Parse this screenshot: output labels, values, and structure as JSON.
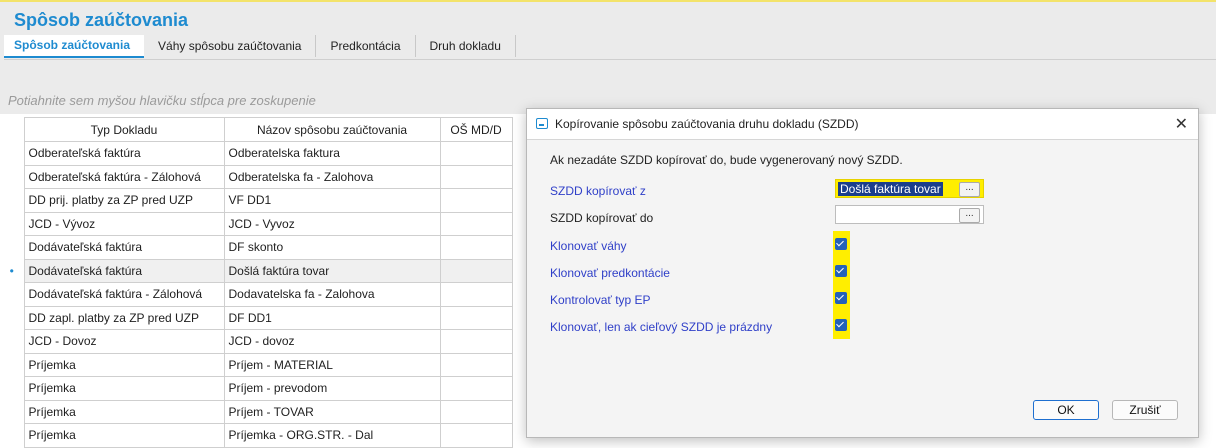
{
  "page": {
    "title": "Spôsob zaúčtovania",
    "tabs": [
      "Spôsob zaúčtovania",
      "Váhy spôsobu zaúčtovania",
      "Predkontácia",
      "Druh dokladu"
    ],
    "group_hint": "Potiahnite sem myšou hlavičku stĺpca pre zoskupenie"
  },
  "grid": {
    "columns": [
      "Typ Dokladu",
      "Názov spôsobu zaúčtovania",
      "OŠ MD/D"
    ],
    "rows": [
      [
        "Odberateľská faktúra",
        "Odberatelska faktura",
        ""
      ],
      [
        "Odberateľská faktúra - Zálohová",
        "Odberatelska fa - Zalohova",
        ""
      ],
      [
        "DD prij. platby za ZP pred UZP",
        "VF DD1",
        ""
      ],
      [
        "JCD - Vývoz",
        "JCD - Vyvoz",
        ""
      ],
      [
        "Dodávateľská faktúra",
        "DF skonto",
        ""
      ],
      [
        "Dodávateľská faktúra",
        "Došlá faktúra tovar",
        ""
      ],
      [
        "Dodávateľská faktúra - Zálohová",
        "Dodavatelska fa - Zalohova",
        ""
      ],
      [
        "DD zapl. platby za ZP pred UZP",
        "DF DD1",
        ""
      ],
      [
        "JCD - Dovoz",
        "JCD - dovoz",
        ""
      ],
      [
        "Príjemka",
        "Príjem - MATERIAL",
        ""
      ],
      [
        "Príjemka",
        "Príjem - prevodom",
        ""
      ],
      [
        "Príjemka",
        "Príjem - TOVAR",
        ""
      ],
      [
        "Príjemka",
        "Príjemka - ORG.STR. - Dal",
        ""
      ]
    ],
    "selected_row": 5,
    "row_indicator": "•"
  },
  "dialog": {
    "title": "Kopírovanie spôsobu zaúčtovania druhu dokladu (SZDD)",
    "info": "Ak nezadáte SZDD kopírovať do, bude vygenerovaný nový SZDD.",
    "copy_from_label": "SZDD kopírovať z",
    "copy_from_value": "Došlá faktúra tovar",
    "copy_to_label": "SZDD kopírovať do",
    "copy_to_value": "",
    "ellipsis": "...",
    "clone_weights_label": "Klonovať váhy",
    "clone_predkontacie_label": "Klonovať predkontácie",
    "check_type_label": "Kontrolovať typ EP",
    "clone_only_empty_label": "Klonovať, len ak cieľový SZDD je prázdny",
    "ok_label": "OK",
    "cancel_label": "Zrušiť",
    "close_glyph": "✕",
    "highlight_color": "#ffee00"
  },
  "colors": {
    "accent": "#1e8bd0",
    "label_blue": "#2f3fc8",
    "checkbox": "#2461b9"
  }
}
